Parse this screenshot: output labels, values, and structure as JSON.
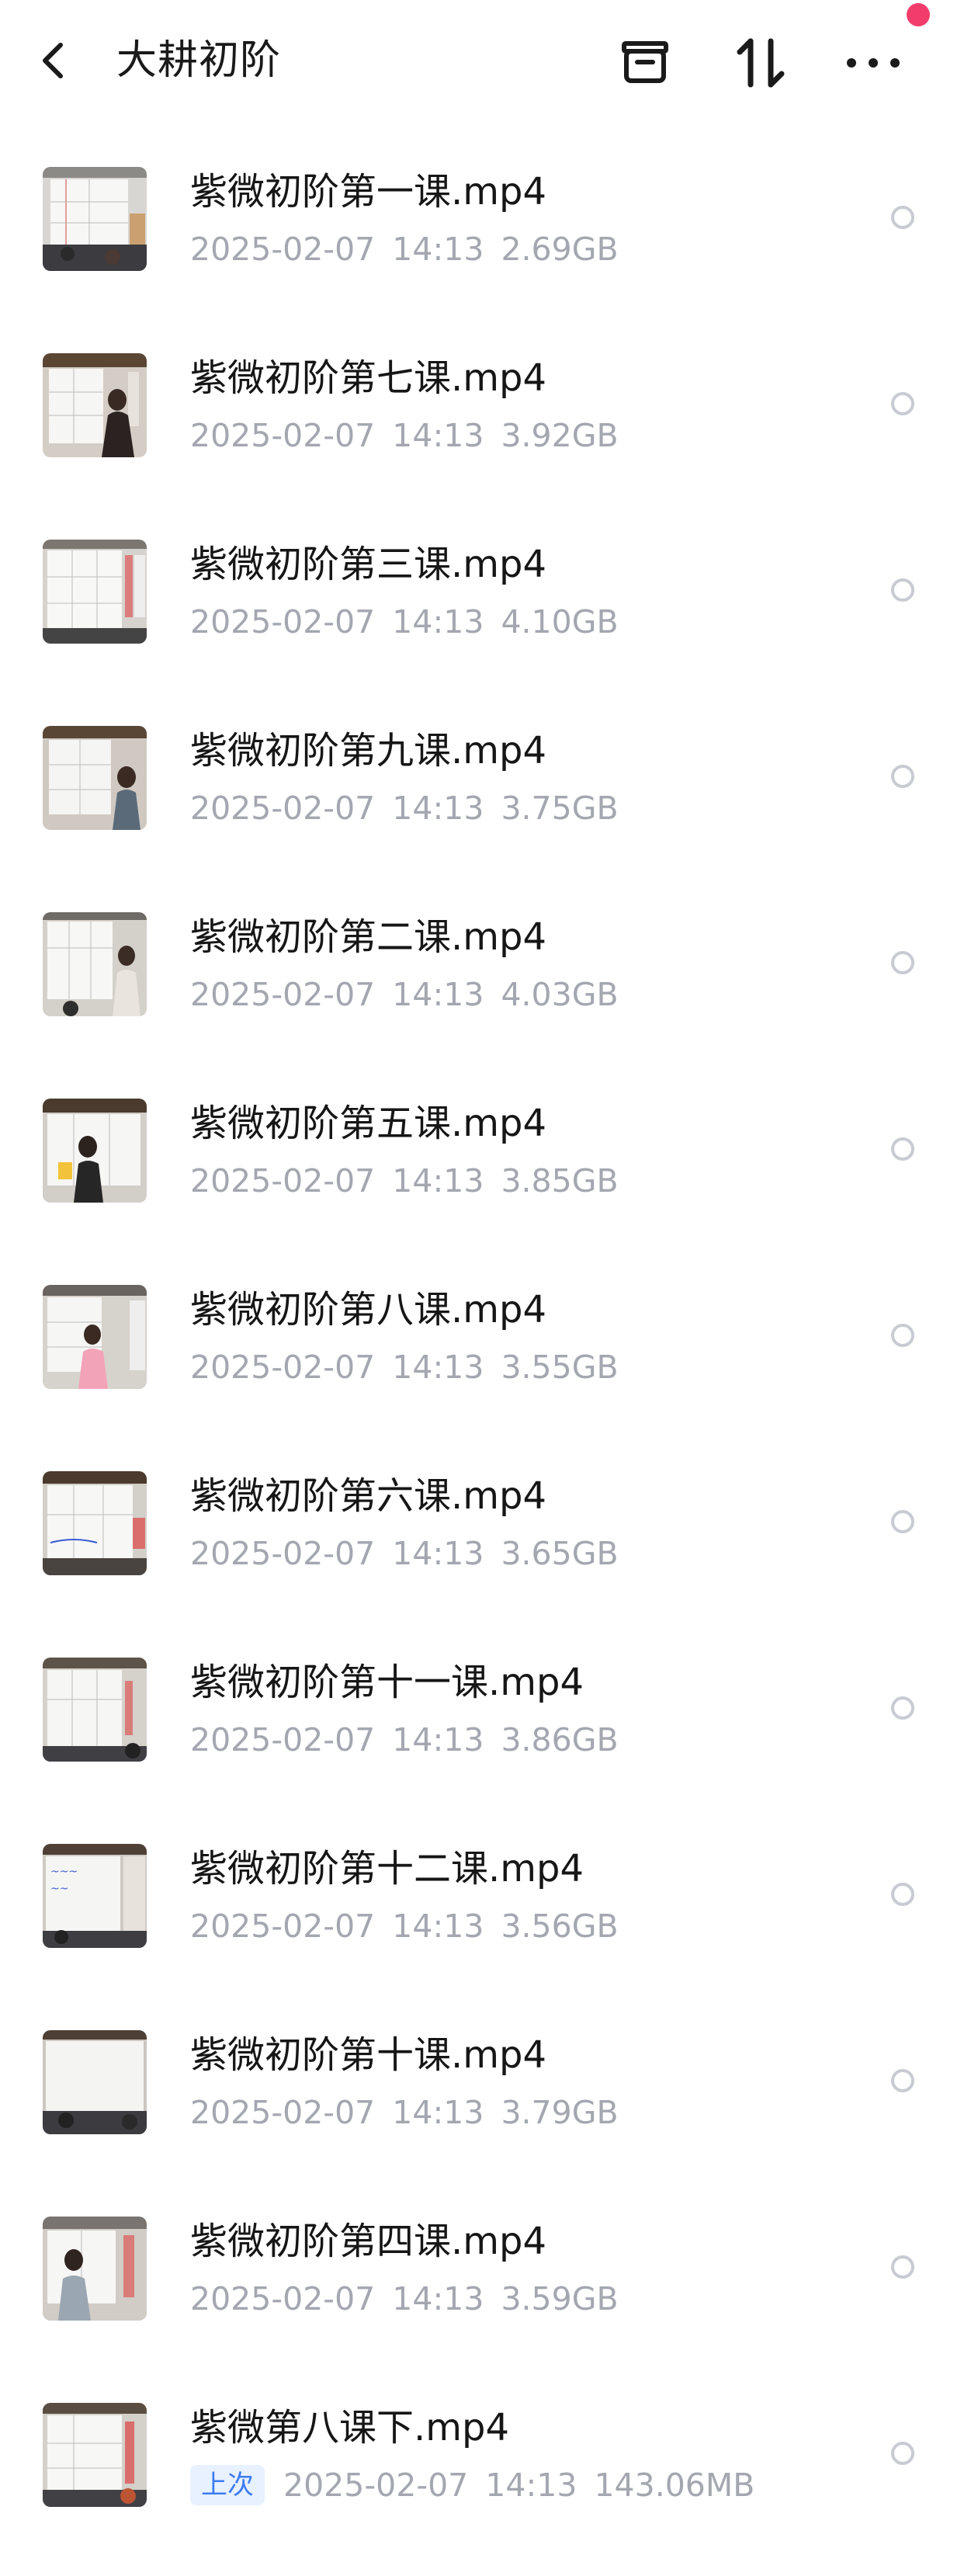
{
  "header": {
    "title": "大耕初阶",
    "icons": {
      "back": "chevron-left-icon",
      "archive": "archive-box-icon",
      "sort": "sort-arrows-icon",
      "more": "more-dots-icon"
    },
    "notification_dot_color": "#f23d6c"
  },
  "files": [
    {
      "name": "紫微初阶第一课.mp4",
      "date": "2025-02-07",
      "time": "14:13",
      "size": "2.69GB"
    },
    {
      "name": "紫微初阶第七课.mp4",
      "date": "2025-02-07",
      "time": "14:13",
      "size": "3.92GB"
    },
    {
      "name": "紫微初阶第三课.mp4",
      "date": "2025-02-07",
      "time": "14:13",
      "size": "4.10GB"
    },
    {
      "name": "紫微初阶第九课.mp4",
      "date": "2025-02-07",
      "time": "14:13",
      "size": "3.75GB"
    },
    {
      "name": "紫微初阶第二课.mp4",
      "date": "2025-02-07",
      "time": "14:13",
      "size": "4.03GB"
    },
    {
      "name": "紫微初阶第五课.mp4",
      "date": "2025-02-07",
      "time": "14:13",
      "size": "3.85GB"
    },
    {
      "name": "紫微初阶第八课.mp4",
      "date": "2025-02-07",
      "time": "14:13",
      "size": "3.55GB"
    },
    {
      "name": "紫微初阶第六课.mp4",
      "date": "2025-02-07",
      "time": "14:13",
      "size": "3.65GB"
    },
    {
      "name": "紫微初阶第十一课.mp4",
      "date": "2025-02-07",
      "time": "14:13",
      "size": "3.86GB"
    },
    {
      "name": "紫微初阶第十二课.mp4",
      "date": "2025-02-07",
      "time": "14:13",
      "size": "3.56GB"
    },
    {
      "name": "紫微初阶第十课.mp4",
      "date": "2025-02-07",
      "time": "14:13",
      "size": "3.79GB"
    },
    {
      "name": "紫微初阶第四课.mp4",
      "date": "2025-02-07",
      "time": "14:13",
      "size": "3.59GB"
    },
    {
      "name": "紫微第八课下.mp4",
      "date": "2025-02-07",
      "time": "14:13",
      "size": "143.06MB",
      "tag": "上次"
    }
  ],
  "colors": {
    "meta_text": "#a4a7b0",
    "tag_bg": "#e8f1ff",
    "tag_text": "#3d7cf2",
    "radio_border": "#c9cbd2"
  }
}
